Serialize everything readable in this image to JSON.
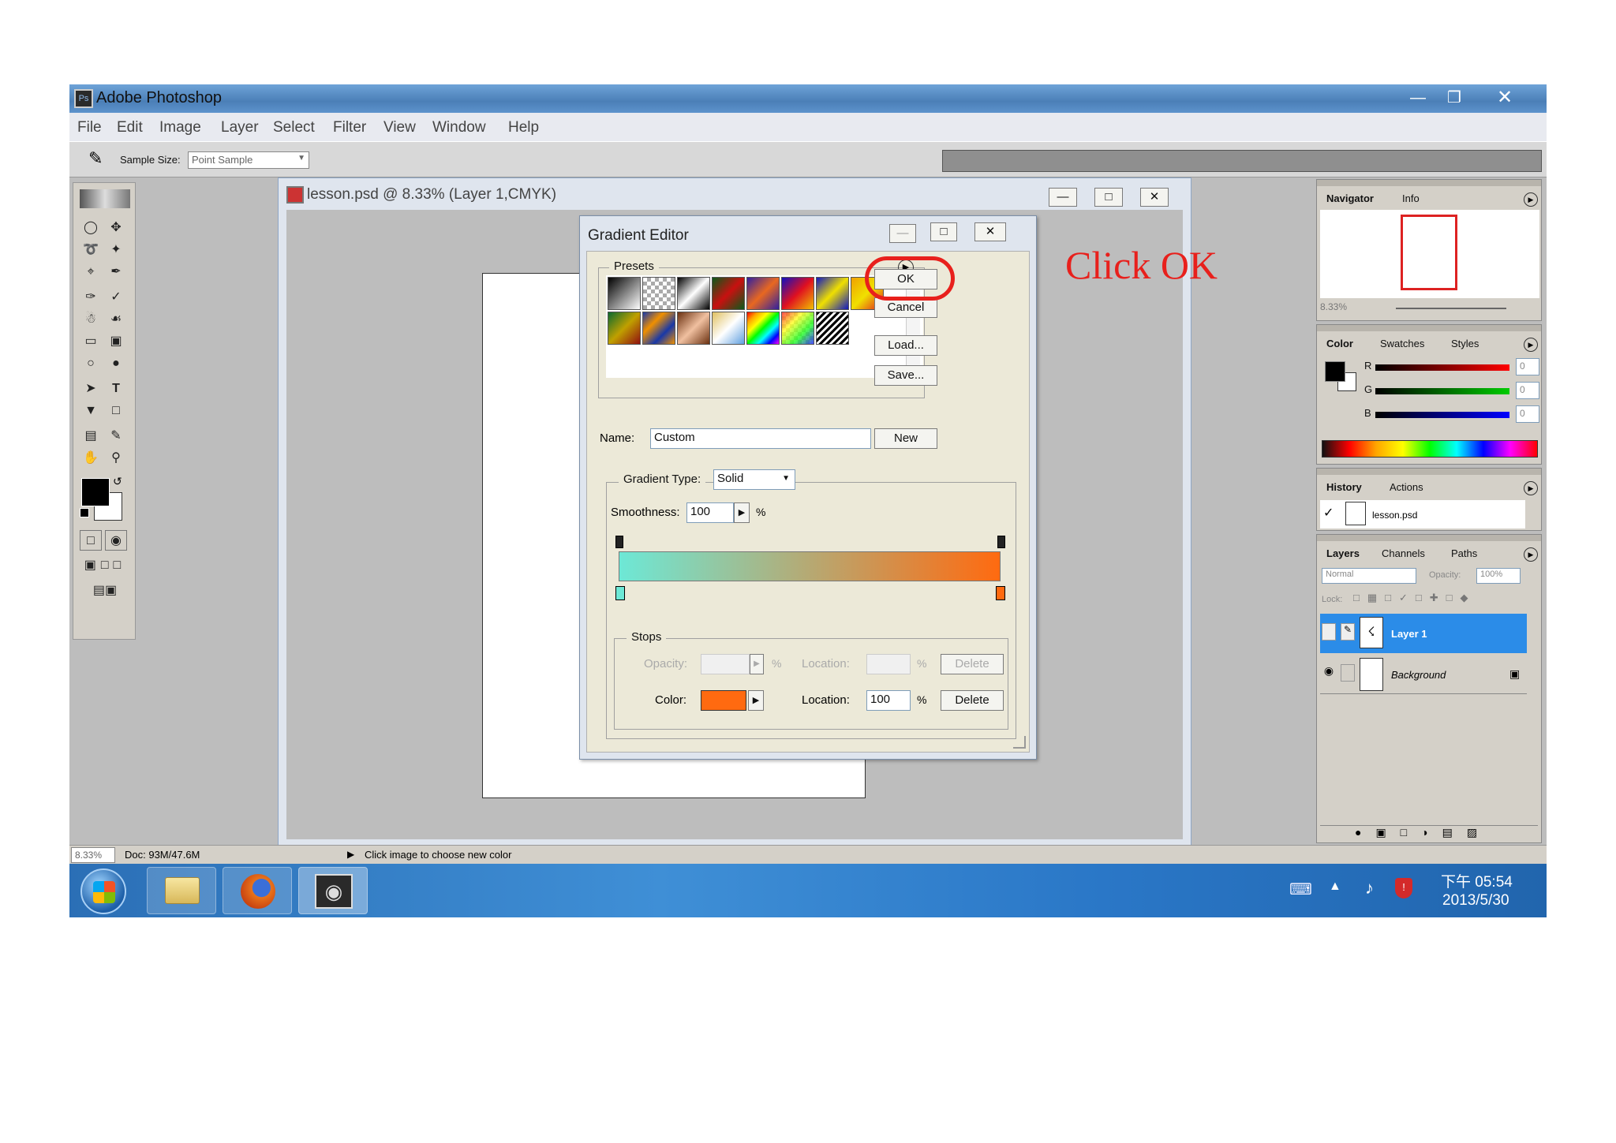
{
  "window": {
    "title": "Adobe Photoshop"
  },
  "menu": [
    "File",
    "Edit",
    "Image",
    "Layer",
    "Select",
    "Filter",
    "View",
    "Window",
    "Help"
  ],
  "options_bar": {
    "sample_size_label": "Sample Size:",
    "sample_size_value": "Point Sample"
  },
  "document": {
    "title": "lesson.psd @ 8.33% (Layer 1,CMYK)"
  },
  "gradient_editor": {
    "title": "Gradient Editor",
    "presets_label": "Presets",
    "buttons": {
      "ok": "OK",
      "cancel": "Cancel",
      "load": "Load...",
      "save": "Save...",
      "new": "New"
    },
    "name_label": "Name:",
    "name_value": "Custom",
    "gradient_type_label": "Gradient Type:",
    "gradient_type_value": "Solid",
    "smoothness_label": "Smoothness:",
    "smoothness_value": "100",
    "percent": "%",
    "stops_label": "Stops",
    "opacity_label": "Opacity:",
    "location_label": "Location:",
    "delete_label": "Delete",
    "color_label": "Color:",
    "color_location_value": "100",
    "gradient_start_color": "#6de8d6",
    "gradient_end_color": "#ff6a10"
  },
  "annotation": {
    "text": "Click OK",
    "color": "#e8201c"
  },
  "navigator": {
    "tabs": [
      "Navigator",
      "Info"
    ],
    "zoom": "8.33%"
  },
  "color_panel": {
    "tabs": [
      "Color",
      "Swatches",
      "Styles"
    ],
    "channels": [
      {
        "label": "R",
        "value": "0"
      },
      {
        "label": "G",
        "value": "0"
      },
      {
        "label": "B",
        "value": "0"
      }
    ]
  },
  "history_panel": {
    "tabs": [
      "History",
      "Actions"
    ],
    "item": "lesson.psd"
  },
  "layers_panel": {
    "tabs": [
      "Layers",
      "Channels",
      "Paths"
    ],
    "blend_mode": "Normal",
    "opacity_label": "Opacity:",
    "opacity_value": "100%",
    "lock_label": "Lock:",
    "layers": [
      {
        "name": "Layer 1",
        "selected": true
      },
      {
        "name": "Background",
        "selected": false
      }
    ]
  },
  "status_bar": {
    "zoom": "8.33%",
    "doc": "Doc: 93M/47.6M",
    "hint": "Click image to choose new color"
  },
  "taskbar": {
    "time": "下午 05:54",
    "date": "2013/5/30"
  }
}
